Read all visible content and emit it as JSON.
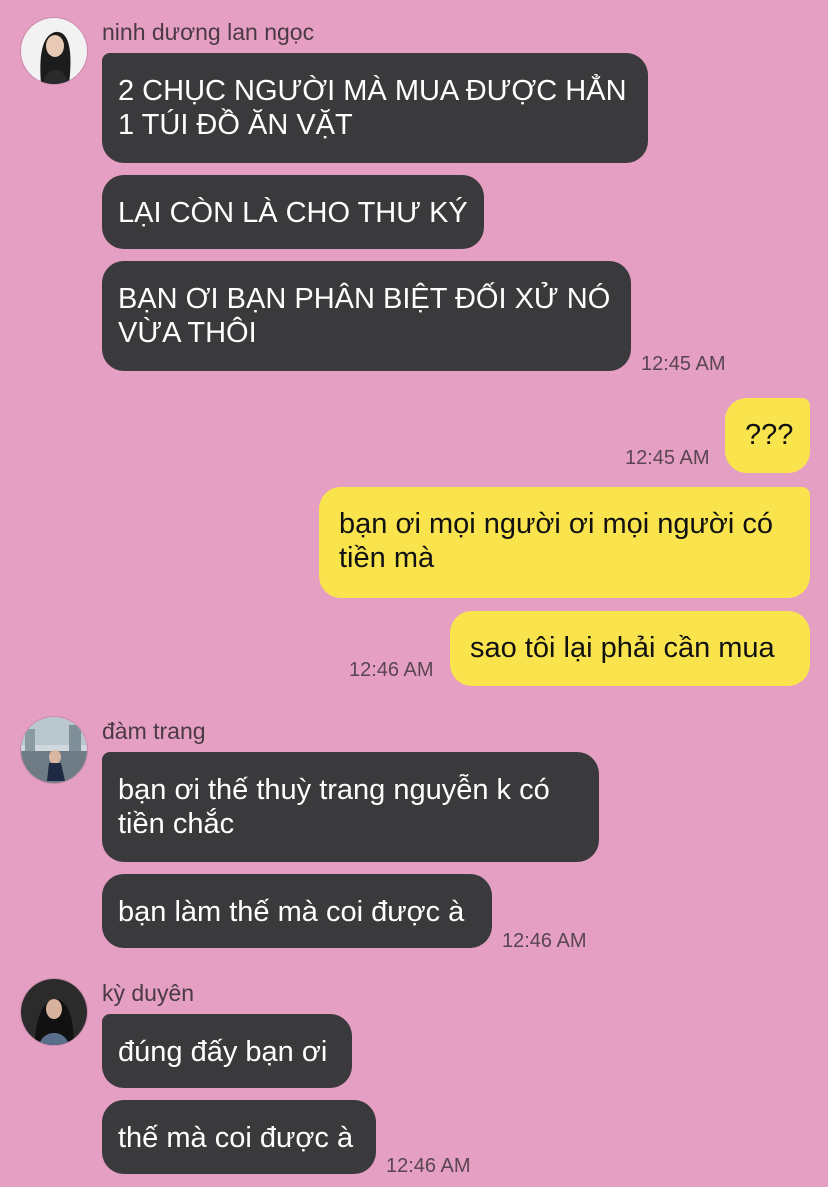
{
  "chat": {
    "groups": [
      {
        "sender": "ninh dương lan ngọc",
        "messages": [
          "2 CHỤC NGƯỜI MÀ MUA ĐƯỢC HẲN\n1 TÚI ĐỒ ĂN VẶT",
          "LẠI CÒN LÀ CHO THƯ KÝ",
          "BẠN ƠI BẠN PHÂN BIỆT ĐỐI XỬ NÓ\nVỪA THÔI"
        ],
        "time": "12:45 AM"
      },
      {
        "sender": "me",
        "messages": [
          "???"
        ],
        "time": "12:45 AM"
      },
      {
        "sender": "me",
        "messages": [
          "bạn ơi mọi người ơi mọi người có\ntiền mà",
          "sao tôi lại phải cần mua"
        ],
        "time": "12:46 AM"
      },
      {
        "sender": "đàm trang",
        "messages": [
          "bạn ơi thế thuỳ trang nguyễn k có\ntiền chắc",
          "bạn làm thế mà coi được à"
        ],
        "time": "12:46 AM"
      },
      {
        "sender": "kỳ duyên",
        "messages": [
          "đúng đấy bạn ơi",
          "thế mà coi được à"
        ],
        "time": "12:46 AM"
      }
    ]
  },
  "colors": {
    "background": "#e59fc2",
    "incoming_bubble": "#3a393b",
    "outgoing_bubble": "#fae44e"
  }
}
